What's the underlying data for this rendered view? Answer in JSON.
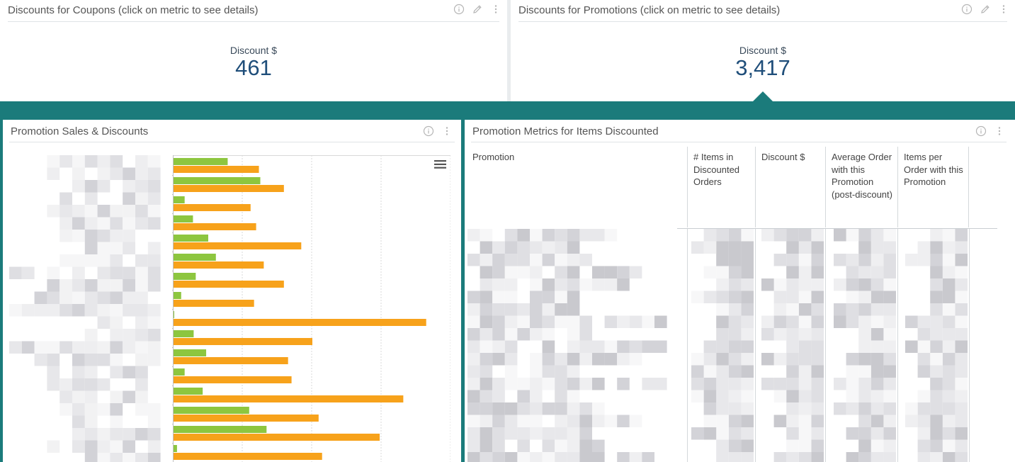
{
  "kpi": {
    "coupons": {
      "title": "Discounts for Coupons (click on metric to see details)",
      "label": "Discount $",
      "value": "461"
    },
    "promotions": {
      "title": "Discounts for Promotions (click on metric to see details)",
      "label": "Discount $",
      "value": "3,417"
    }
  },
  "chart": {
    "title": "Promotion Sales & Discounts",
    "colors": {
      "series_a": "#8dc63f",
      "series_b": "#f7a21b",
      "grid": "#d9d9d9",
      "axis": "#c0c0c0"
    },
    "icons": [
      "info-icon",
      "more-vertical-icon",
      "hamburger-menu-icon"
    ]
  },
  "chart_data": {
    "type": "bar",
    "orientation": "horizontal",
    "categories": [
      "",
      "",
      "",
      "",
      "",
      "",
      "",
      "",
      "",
      "",
      "",
      "",
      "",
      "",
      "",
      ""
    ],
    "series": [
      {
        "values": [
          78,
          125,
          16,
          28,
          50,
          61,
          32,
          11,
          1,
          29,
          47,
          16,
          42,
          109,
          134,
          5
        ]
      },
      {
        "values": [
          123,
          159,
          111,
          119,
          184,
          130,
          159,
          116,
          364,
          200,
          165,
          170,
          331,
          209,
          297,
          214
        ]
      }
    ],
    "xlim": [
      0,
      400
    ],
    "grid": true
  },
  "table": {
    "title": "Promotion Metrics for Items Discounted",
    "columns": [
      "Promotion",
      "# Items in Discounted Orders",
      "Discount $",
      "Average Order with this Promotion (post-discount)",
      "Items per Order with this Promotion"
    ],
    "icons": [
      "info-icon",
      "more-vertical-icon"
    ]
  },
  "icons": {
    "info": "info-icon",
    "edit": "pencil-icon",
    "more": "more-vertical-icon"
  }
}
